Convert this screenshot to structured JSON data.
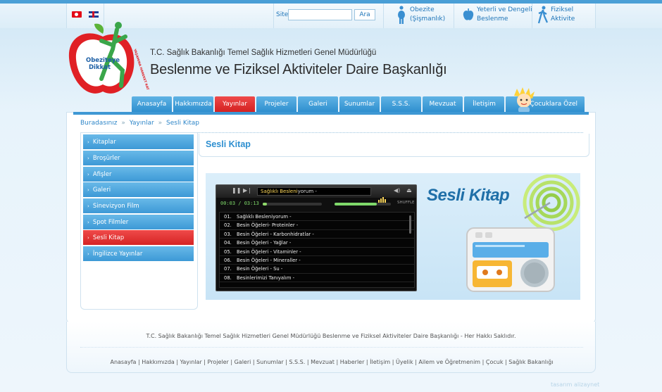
{
  "header": {
    "site_label": "Site",
    "search_value": "",
    "search_button": "Ara",
    "quick_links": [
      {
        "line1": "Obezite",
        "line2": "(Şişmanlık)"
      },
      {
        "line1": "Yeterli ve Dengeli",
        "line2": "Beslenme"
      },
      {
        "line1": "Fiziksel",
        "line2": "Aktivite"
      }
    ],
    "logo_text": "Obeziteye Dikkat",
    "logo_arc": "YAŞAMINA HAREKET KAT",
    "org_sub": "T.C. Sağlık Bakanlığı Temel Sağlık Hizmetleri Genel Müdürlüğü",
    "org_main": "Beslenme ve Fiziksel Aktiviteler Daire Başkanlığı"
  },
  "nav": {
    "items": [
      "Anasayfa",
      "Hakkımızda",
      "Yayınlar",
      "Projeler",
      "Galeri",
      "Sunumlar",
      "S.S.S.",
      "Mevzuat",
      "İletişim",
      "Çocuklara Özel"
    ],
    "active_index": 2
  },
  "breadcrumb": {
    "prefix": "Buradasınız",
    "sep": "»",
    "items": [
      "Yayınlar",
      "Sesli Kitap"
    ]
  },
  "sidebar": {
    "items": [
      "Kitaplar",
      "Broşürler",
      "Afişler",
      "Galeri",
      "Sinevizyon Film",
      "Spot Filmler",
      "Sesli Kitap",
      "İngilizce Yayınlar"
    ],
    "active_index": 6
  },
  "main": {
    "title": "Sesli Kitap",
    "banner_title": "Sesli Kitap"
  },
  "player": {
    "now_playing_title": "Sağlıklı Besleni",
    "now_playing_rest": "yorum -",
    "time": "00:03 / 03:13",
    "shuffle": "SHUFFLE",
    "progress": 0.02,
    "volume": 0.75,
    "tracks": [
      {
        "n": "01.",
        "t": "Sağlıklı Besleniyorum -"
      },
      {
        "n": "02.",
        "t": "Besin Öğeleri- Proteinler -"
      },
      {
        "n": "03.",
        "t": "Besin Öğeleri - Karbonhidratlar -"
      },
      {
        "n": "04.",
        "t": "Besin Öğeleri - Yağlar -"
      },
      {
        "n": "05.",
        "t": "Besin Öğeleri - Vitaminler -"
      },
      {
        "n": "06.",
        "t": "Besin Öğeleri - Mineraller -"
      },
      {
        "n": "07.",
        "t": "Besin Öğeleri - Su -"
      },
      {
        "n": "08.",
        "t": "Besinlerimizi Tanıyalım -"
      }
    ]
  },
  "footer": {
    "copyright": "T.C. Sağlık Bakanlığı Temel Sağlık Hizmetleri Genel Müdürlüğü Beslenme ve Fiziksel Aktiviteler Daire Başkanlığı - Her Hakkı Saklıdır.",
    "links": [
      "Anasayfa",
      "Hakkımızda",
      "Yayınlar",
      "Projeler",
      "Galeri",
      "Sunumlar",
      "S.S.S.",
      "Mevzuat",
      "Haberler",
      "İletişim",
      "Üyelik",
      "Ailem ve Öğretmenim",
      "Çocuk",
      "Sağlık Bakanlığı"
    ],
    "credit": "tasarım alizaynet"
  },
  "colors": {
    "accent": "#3e98d4",
    "active": "#d42121"
  }
}
